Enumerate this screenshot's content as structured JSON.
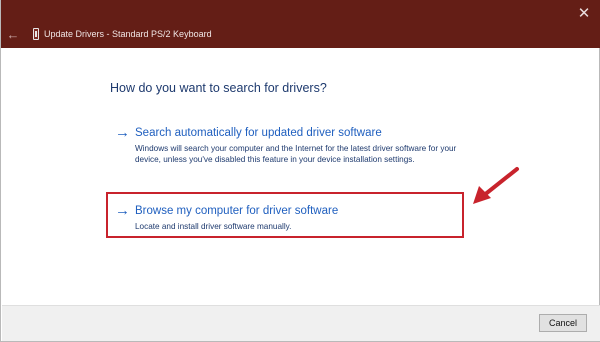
{
  "window": {
    "title": "Update Drivers - Standard PS/2 Keyboard",
    "close_glyph": "✕",
    "back_glyph": "←",
    "titlebar_color": "#641e16"
  },
  "main": {
    "heading": "How do you want to search for drivers?",
    "options": [
      {
        "arrow": "→",
        "title": "Search automatically for updated driver software",
        "description": "Windows will search your computer and the Internet for the latest driver software for your device, unless you've disabled this feature in your device installation settings."
      },
      {
        "arrow": "→",
        "title": "Browse my computer for driver software",
        "description": "Locate and install driver software manually."
      }
    ]
  },
  "footer": {
    "cancel_label": "Cancel"
  },
  "colors": {
    "link": "#1f5fbf",
    "annotation": "#c8232c"
  },
  "icons": {
    "app": "keyboard-device-icon",
    "back": "back-arrow-icon",
    "close": "close-icon",
    "option_arrow": "right-arrow-icon",
    "annotation": "red-pointer-arrow-icon"
  }
}
